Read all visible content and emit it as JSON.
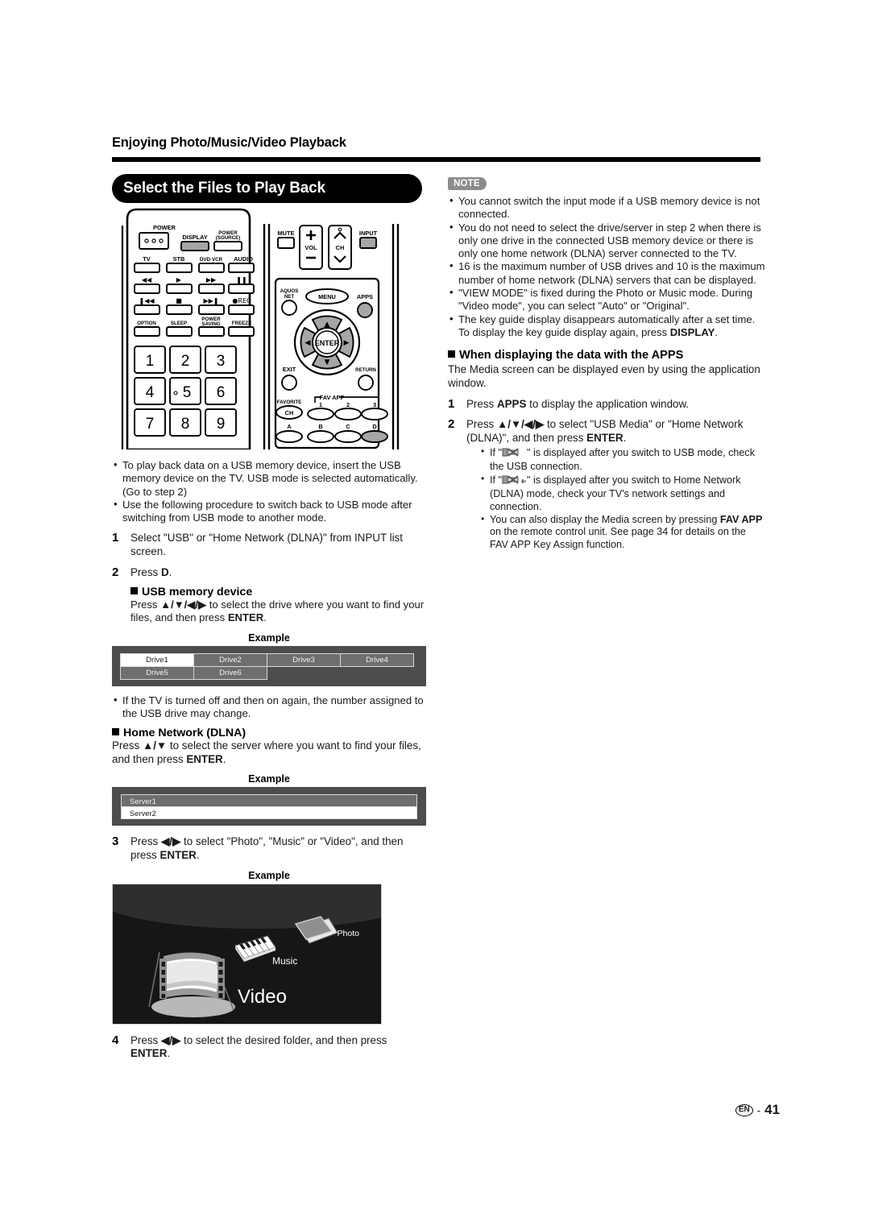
{
  "header": {
    "chapter_title": "Enjoying Photo/Music/Video Playback",
    "section_title": "Select the Files to Play Back"
  },
  "note_badge": "NOTE",
  "left_column": {
    "intro_bullets": [
      "To play back data on a USB memory device, insert the USB memory device on the TV. USB mode is selected automatically. (Go to step 2)",
      "Use the following procedure to switch back to USB mode after switching from USB mode to another mode."
    ],
    "step1": {
      "num": "1",
      "text": "Select \"USB\" or \"Home Network (DLNA)\" from INPUT list screen."
    },
    "step2": {
      "num": "2",
      "text_pre": "Press ",
      "text_bold": "D",
      "text_post": "."
    },
    "usb_heading": "USB memory device",
    "usb_instruction_pre": "Press ",
    "usb_instruction_keys": "▲/▼/◀/▶",
    "usb_instruction_mid": " to select the drive where you want to find your files, and then press ",
    "usb_instruction_bold": "ENTER",
    "usb_instruction_post": ".",
    "example_caption": "Example",
    "drive_table": {
      "cells": [
        "Drive1",
        "Drive2",
        "Drive3",
        "Drive4",
        "Drive5",
        "Drive6"
      ],
      "selected_index": 0,
      "columns": 4
    },
    "drive_note": "If the TV is turned off and then on again, the number assigned to the USB drive may change.",
    "dlna_heading": "Home Network (DLNA)",
    "dlna_instruction_pre": "Press ",
    "dlna_instruction_keys": "▲/▼",
    "dlna_instruction_mid": " to select the server where you want to find your files, and then press ",
    "dlna_instruction_bold": "ENTER",
    "dlna_instruction_post": ".",
    "server_table": {
      "rows": [
        "Server1",
        "Server2"
      ],
      "selected_index": 1
    },
    "step3": {
      "num": "3",
      "text_pre": "Press ",
      "text_keys": "◀/▶",
      "text_mid": " to select \"Photo\", \"Music\" or \"Video\", and then press ",
      "text_bold": "ENTER",
      "text_post": "."
    },
    "media_example": {
      "caption": "Example",
      "photo_label": "Photo",
      "music_label": "Music",
      "video_label": "Video"
    },
    "step4": {
      "num": "4",
      "text_pre": "Press ",
      "text_keys": "◀/▶",
      "text_mid": " to select the desired folder, and then press ",
      "text_bold": "ENTER",
      "text_post": "."
    }
  },
  "right_column": {
    "notes": [
      "You cannot switch the input mode if a USB memory device is not connected.",
      "You do not need to select the drive/server in step 2 when there is only one drive in the connected USB memory device or there is only one home network (DLNA) server connected to the TV.",
      "16 is the maximum number of USB drives and 10 is the maximum number of home network (DLNA) servers that can be displayed.",
      "\"VIEW MODE\" is fixed during the Photo or Music mode. During \"Video mode\", you can select \"Auto\" or \"Original\".",
      "The key guide display disappears automatically after a set time. To display the key guide display again, press DISPLAY."
    ],
    "apps_heading": "When displaying the data with the APPS",
    "apps_intro": "The Media screen can be displayed even by using the application window.",
    "apps_step1": {
      "num": "1",
      "text_pre": "Press ",
      "text_bold": "APPS",
      "text_post": " to display the application window."
    },
    "apps_step2": {
      "num": "2",
      "text_pre": "Press ",
      "text_keys": "▲/▼/◀/▶",
      "text_mid": " to select \"USB Media\" or \"Home Network (DLNA)\", and then press ",
      "text_bold": "ENTER",
      "text_post": "."
    },
    "apps_subbullets": [
      {
        "pre": "If \"",
        "icon": "usb-disconnected-icon",
        "post": "\" is displayed after you switch to USB mode, check the USB connection."
      },
      {
        "pre": "If \"",
        "icon": "network-disconnected-icon",
        "post": "\" is displayed after you switch to Home Network (DLNA) mode, check your TV's network settings and connection."
      },
      {
        "pre": "You can also display the Media screen by pressing ",
        "bold": "FAV APP",
        "post": " on the remote control unit. See page 34 for details on the FAV APP Key Assign function."
      }
    ]
  },
  "remote": {
    "left_panel": {
      "power_label": "POWER",
      "display_label": "DISPLAY",
      "power_source_label_1": "POWER",
      "power_source_label_2": "(SOURCE)",
      "device_buttons": [
        "TV",
        "STB",
        "DVD·VCR",
        "AUDIO"
      ],
      "transport_row1": [
        "◀◀",
        "▶",
        "▶▶",
        "❙❙"
      ],
      "transport_row2": [
        "❙◀◀",
        "■",
        "▶▶❙",
        "●REC"
      ],
      "function_buttons": [
        "OPTION",
        "SLEEP",
        "POWER SAVING",
        "FREEZE"
      ],
      "numbers": [
        "1",
        "2",
        "3",
        "4",
        "5",
        "6",
        "7",
        "8",
        "9"
      ]
    },
    "right_panel": {
      "mute_label": "MUTE",
      "vol_label": "VOL",
      "ch_label": "CH",
      "input_label": "INPUT",
      "aquos_net_label_1": "AQUOS",
      "aquos_net_label_2": "NET",
      "menu_label": "MENU",
      "apps_label": "APPS",
      "enter_label": "ENTER",
      "exit_label": "EXIT",
      "return_label": "RETURN",
      "favorite_label": "FAVORITE",
      "favorite_ch_label": "CH",
      "fav_app_label": "FAV APP",
      "fav_app_numbers": [
        "1",
        "2",
        "3"
      ],
      "abcd_buttons": [
        "A",
        "B",
        "C",
        "D"
      ]
    },
    "highlight_color": "#a6a6a6"
  },
  "footer": {
    "lang_code": "EN",
    "dash": "-",
    "page_number": "41"
  }
}
